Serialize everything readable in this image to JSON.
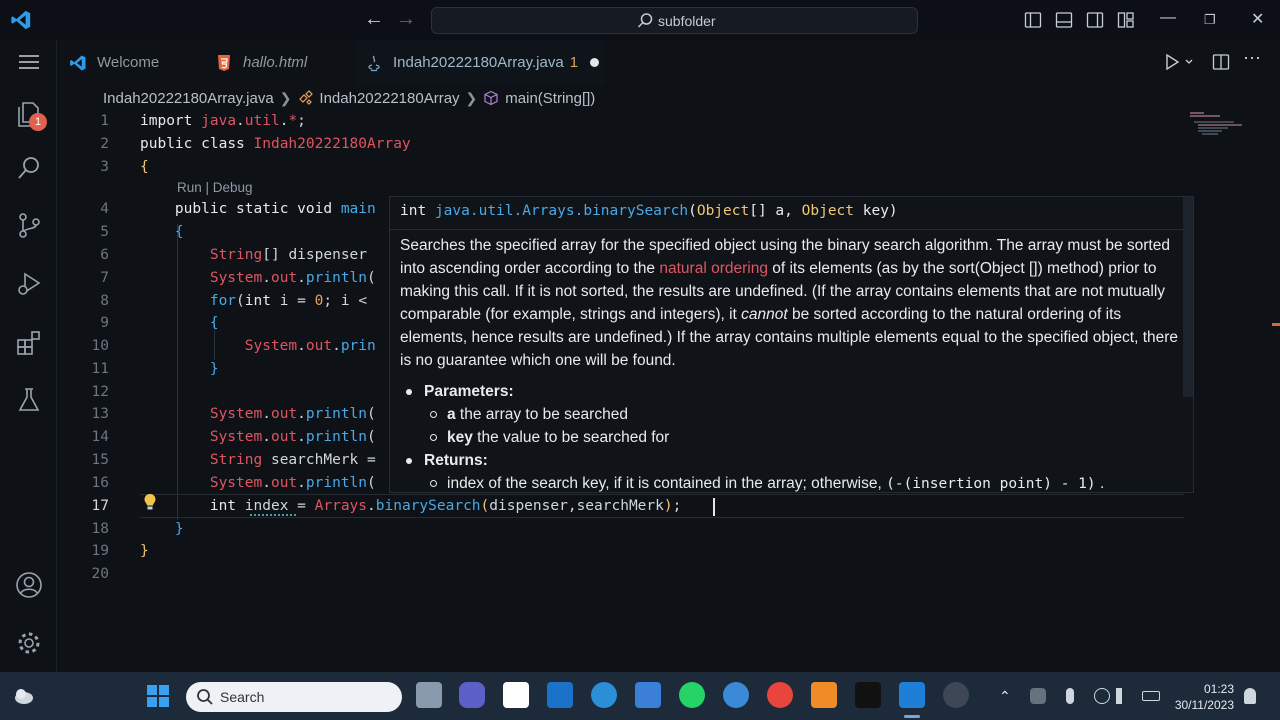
{
  "titlebar": {
    "search_text": "subfolder"
  },
  "tabs": [
    {
      "label": "Welcome",
      "icon": "vscode-icon"
    },
    {
      "label": "hallo.html",
      "icon": "html5-icon"
    },
    {
      "label": "Indah20222180Array.java",
      "icon": "java-icon",
      "problems": "1",
      "dirty": true
    }
  ],
  "breadcrumb": {
    "file": "Indah20222180Array.java",
    "class": "Indah20222180Array",
    "method": "main(String[])"
  },
  "activity": {
    "explorer_badge": "1"
  },
  "editor": {
    "codelens": "Run | Debug",
    "line_numbers": [
      "1",
      "2",
      "3",
      "4",
      "5",
      "6",
      "7",
      "8",
      "9",
      "10",
      "11",
      "12",
      "13",
      "14",
      "15",
      "16",
      "17",
      "18",
      "19",
      "20"
    ],
    "current_line": "17"
  },
  "hover": {
    "signature_ret": "int",
    "signature_fn": "java.util.Arrays.binarySearch",
    "signature_open": "(",
    "signature_t1": "Object",
    "signature_p1": "[] a, ",
    "signature_t2": "Object",
    "signature_p2": " key)",
    "desc_1": "Searches the specified array for the specified object using the binary search algorithm. The array must be sorted into ascending order according to the ",
    "desc_link": "natural ordering",
    "desc_2": " of its elements (as by the sort(Object []) method) prior to making this call. If it is not sorted, the results are undefined. (If the array contains elements that are not mutually comparable (for example, strings and integers), it ",
    "desc_em": "cannot",
    "desc_3": " be sorted according to the natural ordering of its elements, hence results are undefined.) If the array contains multiple elements equal to the specified object, there is no guarantee which one will be found.",
    "params_label": "Parameters:",
    "param_a_name": "a",
    "param_a_desc": " the array to be searched",
    "param_key_name": "key",
    "param_key_desc": " the value to be searched for",
    "returns_label": "Returns:",
    "returns_desc": "index of the search key, if it is contained in the array; otherwise, ",
    "returns_code": "(-(insertion point) - 1)",
    "returns_end": "."
  },
  "taskbar": {
    "search_label": "Search",
    "time": "01:23",
    "date": "30/11/2023"
  },
  "colors": {
    "keyword_red": "#e05561",
    "function_blue": "#4aa8e6",
    "type_yellow": "#f0c674",
    "badge": "#e0624e"
  }
}
